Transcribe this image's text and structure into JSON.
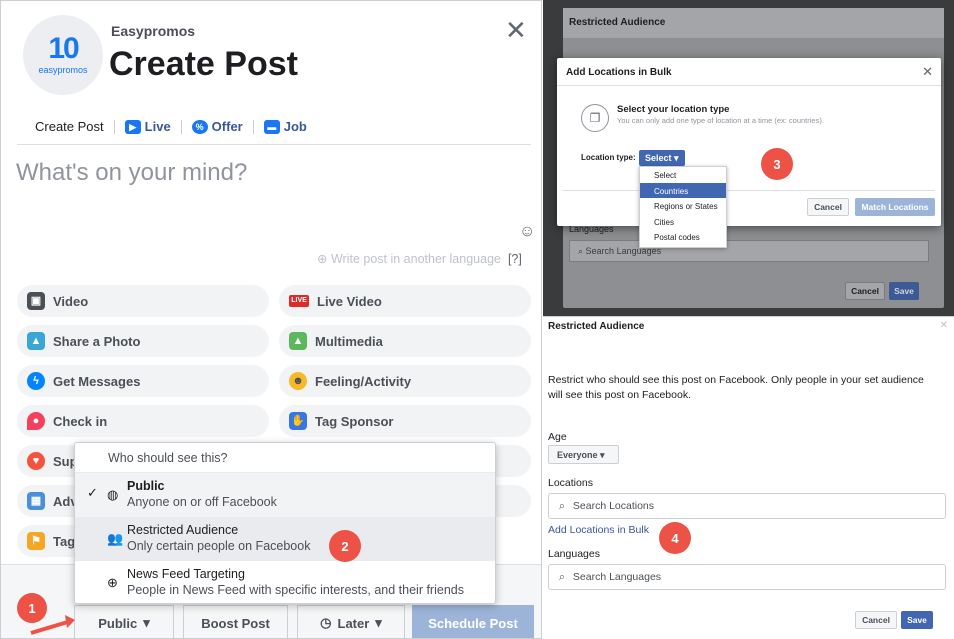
{
  "left": {
    "brand": "Easypromos",
    "logo_number": "10",
    "logo_text": "easypromos",
    "title": "Create Post",
    "tabs": [
      "Create Post",
      "Live",
      "Offer",
      "Job"
    ],
    "placeholder": "What's on your mind?",
    "write_another": "Write post in another language",
    "help": "[?]",
    "actions": [
      "Video",
      "Live Video",
      "Share a Photo",
      "Multimedia",
      "Get Messages",
      "Feeling/Activity",
      "Check in",
      "Tag Sponsor",
      "Sup",
      "Adv",
      "Tag"
    ],
    "audience_button": "Public",
    "boost_button": "Boost Post",
    "later_button": "Later",
    "schedule_button": "Schedule Post"
  },
  "dropdown": {
    "heading": "Who should see this?",
    "options": [
      {
        "title": "Public",
        "subtitle": "Anyone on or off Facebook"
      },
      {
        "title": "Restricted Audience",
        "subtitle": "Only certain people on Facebook"
      },
      {
        "title": "News Feed Targeting",
        "subtitle": "People in News Feed with specific interests, and their friends"
      }
    ]
  },
  "steps": [
    "1",
    "2",
    "3",
    "4"
  ],
  "bulk": {
    "bg_title": "Restricted Audience",
    "title": "Add Locations in Bulk",
    "heading": "Select your location type",
    "subheading": "You can only add one type of location at a time (ex: countries).",
    "type_label": "Location type:",
    "select_label": "Select",
    "menu": [
      "Select",
      "Countries",
      "Regions or States",
      "Cities",
      "Postal codes"
    ],
    "cancel": "Cancel",
    "match": "Match Locations",
    "languages_label": "Languages",
    "search_languages": "Search Languages",
    "bg_cancel": "Cancel",
    "bg_save": "Save"
  },
  "restricted": {
    "title": "Restricted Audience",
    "description": "Restrict who should see this post on Facebook. Only people in your set audience will see this post on Facebook.",
    "age_label": "Age",
    "age_value": "Everyone",
    "locations_label": "Locations",
    "search_locations": "Search Locations",
    "bulk_link": "Add Locations in Bulk",
    "languages_label": "Languages",
    "search_languages": "Search Languages",
    "cancel": "Cancel",
    "save": "Save"
  },
  "colors": {
    "badge": "#ec5246",
    "facebook_blue": "#4267b2",
    "link": "#385898"
  }
}
